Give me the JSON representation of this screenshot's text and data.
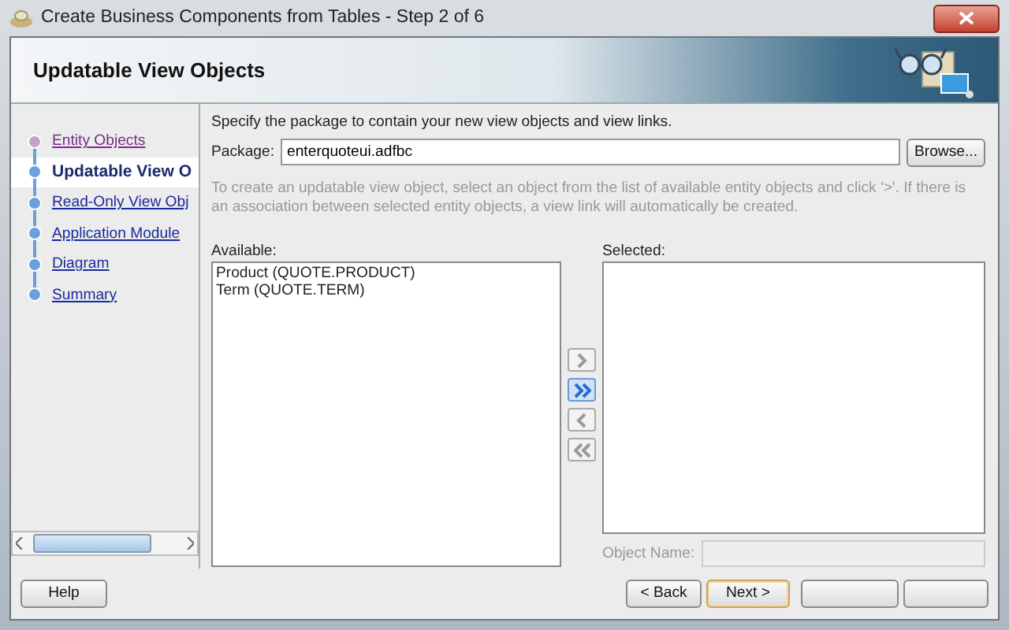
{
  "window": {
    "title": "Create Business Components from Tables - Step 2 of 6"
  },
  "header": {
    "title": "Updatable View Objects"
  },
  "steps": [
    {
      "label": "Entity Objects",
      "kind": "visited"
    },
    {
      "label": "Updatable View O",
      "kind": "current"
    },
    {
      "label": "Read-Only View Obj",
      "kind": "pending"
    },
    {
      "label": "Application Module",
      "kind": "pending"
    },
    {
      "label": "Diagram",
      "kind": "pending"
    },
    {
      "label": "Summary",
      "kind": "pending"
    }
  ],
  "package": {
    "intro": "Specify the package to contain your new view objects and view links.",
    "label": "Package:",
    "value": "enterquoteui.adfbc",
    "browse": "Browse..."
  },
  "instructions": "To create an updatable view object, select an object from the list of available entity objects and click '>'.  If there is an association between selected entity objects, a view link will automatically be created.",
  "available": {
    "label": "Available:",
    "items": [
      "Product (QUOTE.PRODUCT)",
      "Term (QUOTE.TERM)"
    ]
  },
  "move_buttons": [
    {
      "kind": "add",
      "disabled": true
    },
    {
      "kind": "add_all",
      "disabled": false
    },
    {
      "kind": "remove",
      "disabled": true
    },
    {
      "kind": "remove_all",
      "disabled": true
    }
  ],
  "selected": {
    "label": "Selected:"
  },
  "object_name": {
    "label": "Object Name:",
    "disabled": true
  },
  "buttons": [
    {
      "label": "Help",
      "kind": "help"
    },
    {
      "label": "< Back",
      "kind": "back"
    },
    {
      "label": "Next >",
      "kind": "next"
    },
    {
      "kind": "hidden"
    },
    {
      "kind": "hidden"
    }
  ]
}
